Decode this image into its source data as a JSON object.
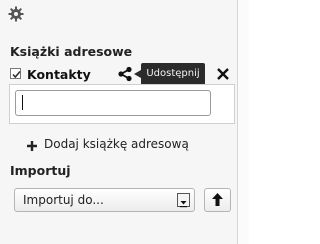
{
  "icons": {
    "settings": "gear-icon",
    "share": "share-icon",
    "close": "close-icon",
    "add": "plus-icon",
    "dropdown": "chevron-down-icon",
    "import": "arrow-up-icon"
  },
  "addressbooks": {
    "title": "Książki adresowe",
    "items": [
      {
        "label": "Kontakty",
        "checked": true
      }
    ],
    "tooltip": "Udostępnij",
    "name_input": {
      "value": "",
      "placeholder": ""
    },
    "add_label": "Dodaj książkę adresową"
  },
  "import": {
    "title": "Importuj",
    "select_value": "Importuj do..."
  },
  "colors": {
    "panel_bg": "#f6f6f6",
    "tooltip_bg": "#2b2b2b",
    "text": "#222222"
  }
}
